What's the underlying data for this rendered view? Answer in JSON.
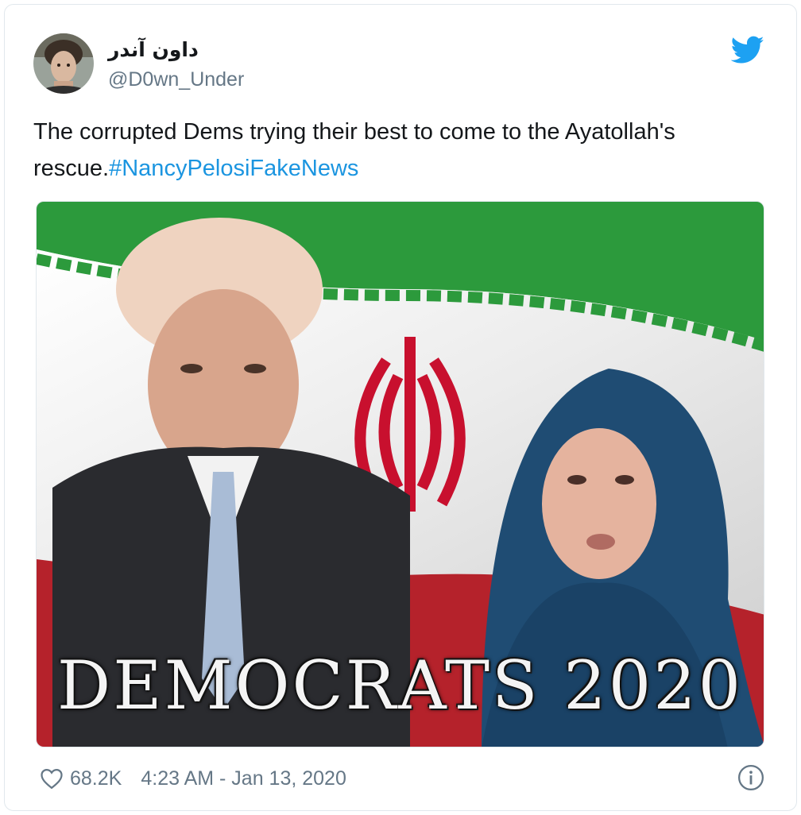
{
  "tweet": {
    "display_name": "داون آندر",
    "handle": "@D0wn_Under",
    "text_before": "The corrupted Dems trying their best to come to the Ayatollah's rescue.",
    "hashtag": "#NancyPelosiFakeNews",
    "image_caption": "DEMOCRATS 2020",
    "likes": "68.2K",
    "timestamp": "4:23 AM - Jan 13, 2020"
  },
  "icons": {
    "brand": "twitter-bird-icon",
    "like": "heart-icon",
    "info": "info-icon"
  },
  "colors": {
    "brand_blue": "#1da1f2",
    "link_blue": "#1b95e0",
    "secondary_text": "#657786",
    "flag_green": "#2c9a3c",
    "flag_red": "#c8102e"
  }
}
